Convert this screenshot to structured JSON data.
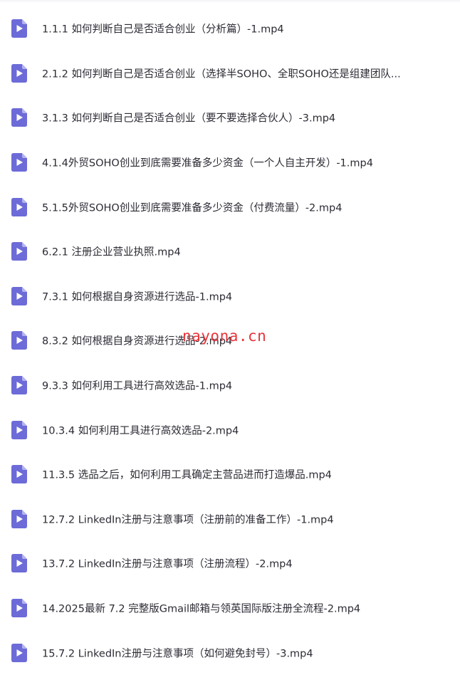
{
  "files": [
    {
      "name": "1.1.1 如何判断自己是否适合创业（分析篇）-1.mp4",
      "icon": "video-file-icon"
    },
    {
      "name": "2.1.2 如何判断自己是否适合创业（选择半SOHO、全职SOHO还是组建团队...",
      "icon": "video-file-icon"
    },
    {
      "name": "3.1.3 如何判断自己是否适合创业（要不要选择合伙人）-3.mp4",
      "icon": "video-file-icon"
    },
    {
      "name": "4.1.4外贸SOHO创业到底需要准备多少资金（一个人自主开发）-1.mp4",
      "icon": "video-file-icon"
    },
    {
      "name": "5.1.5外贸SOHO创业到底需要准备多少资金（付费流量）-2.mp4",
      "icon": "video-file-icon"
    },
    {
      "name": "6.2.1 注册企业营业执照.mp4",
      "icon": "video-file-icon"
    },
    {
      "name": "7.3.1 如何根据自身资源进行选品-1.mp4",
      "icon": "video-file-icon"
    },
    {
      "name": "8.3.2 如何根据自身资源进行选品-2.mp4",
      "icon": "video-file-icon"
    },
    {
      "name": "9.3.3 如何利用工具进行高效选品-1.mp4",
      "icon": "video-file-icon"
    },
    {
      "name": "10.3.4 如何利用工具进行高效选品-2.mp4",
      "icon": "video-file-icon"
    },
    {
      "name": "11.3.5 选品之后，如何利用工具确定主营品进而打造爆品.mp4",
      "icon": "video-file-icon"
    },
    {
      "name": "12.7.2 LinkedIn注册与注意事项（注册前的准备工作）-1.mp4",
      "icon": "video-file-icon"
    },
    {
      "name": "13.7.2 LinkedIn注册与注意事项（注册流程）-2.mp4",
      "icon": "video-file-icon"
    },
    {
      "name": "14.2025最新 7.2 完整版Gmail邮箱与领英国际版注册全流程-2.mp4",
      "icon": "video-file-icon"
    },
    {
      "name": "15.7.2 LinkedIn注册与注意事项（如何避免封号）-3.mp4",
      "icon": "video-file-icon"
    }
  ],
  "watermark": "nayona.cn",
  "colors": {
    "icon_fill": "#6c6bd8",
    "icon_fold": "#b3b3ef",
    "text": "#2b2b34",
    "watermark": "#e8343a"
  }
}
